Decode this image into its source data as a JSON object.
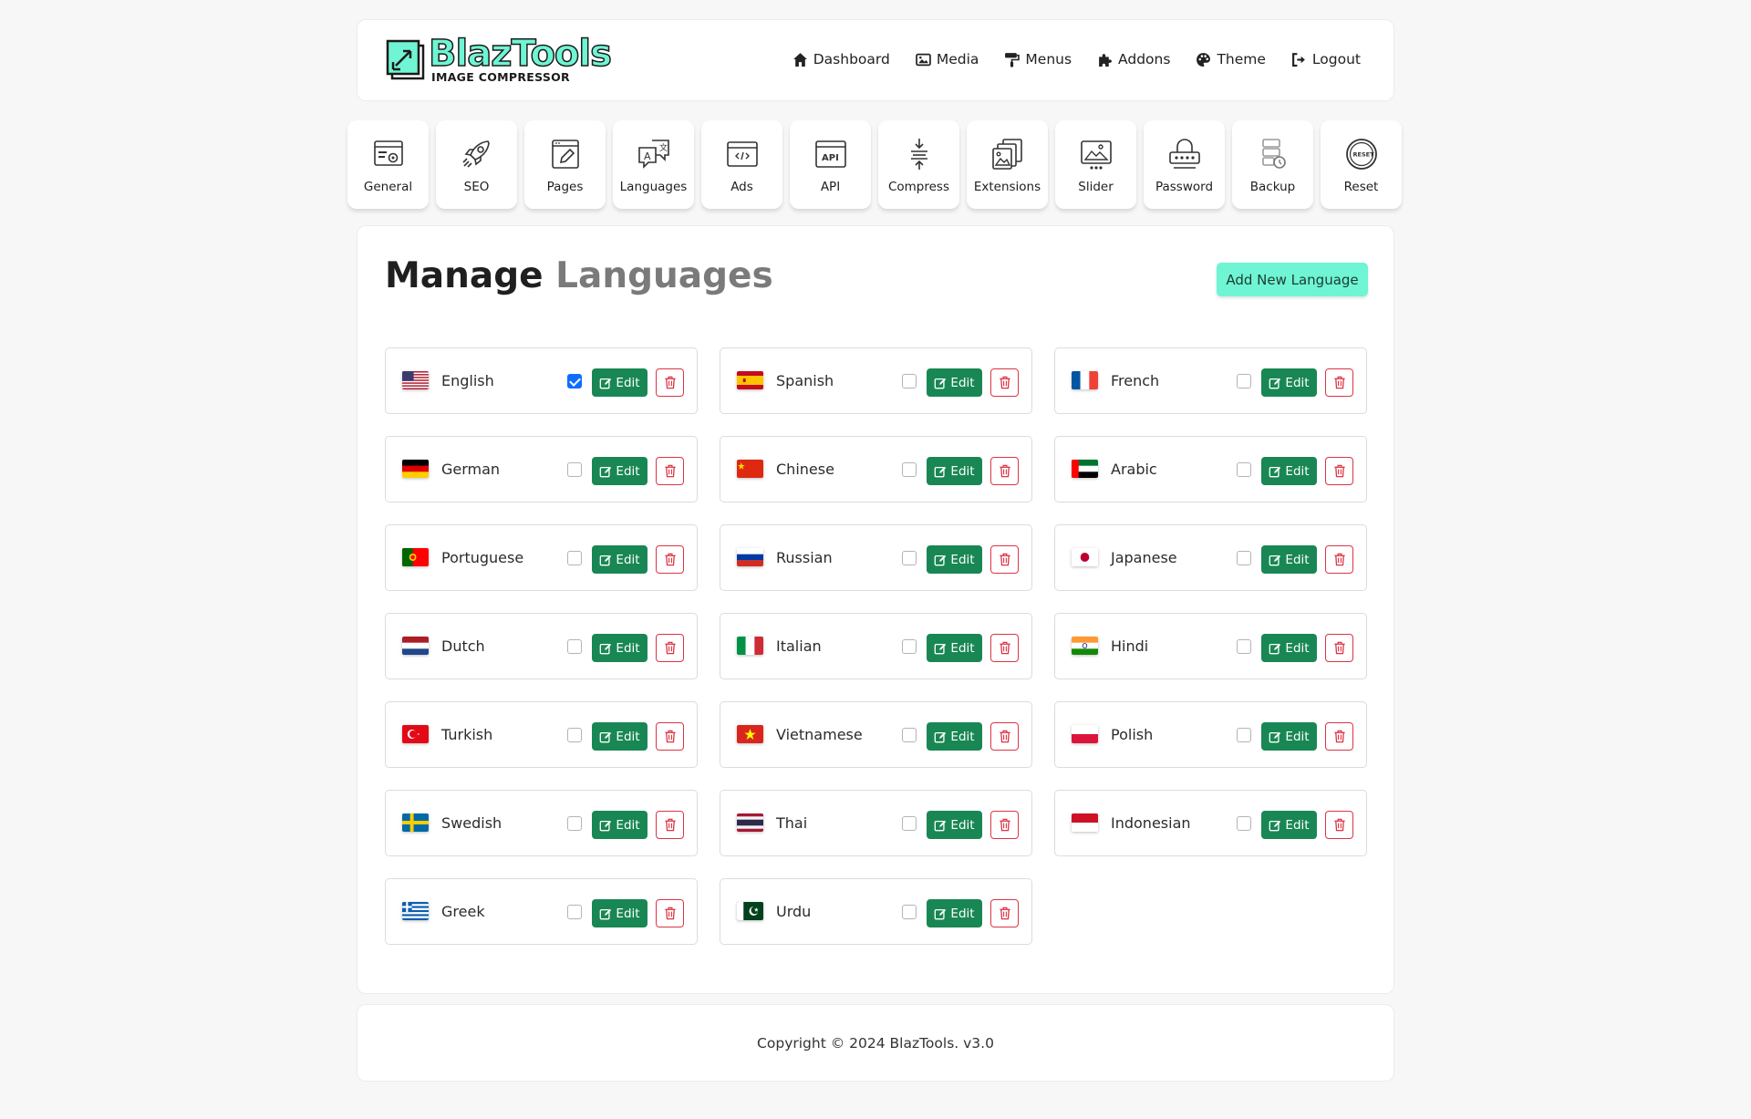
{
  "brand": {
    "name": "BlazTools",
    "tagline": "IMAGE COMPRESSOR"
  },
  "nav": [
    {
      "label": "Dashboard",
      "icon": "home-icon"
    },
    {
      "label": "Media",
      "icon": "image-icon"
    },
    {
      "label": "Menus",
      "icon": "paint-roller-icon"
    },
    {
      "label": "Addons",
      "icon": "puzzle-icon"
    },
    {
      "label": "Theme",
      "icon": "palette-icon"
    },
    {
      "label": "Logout",
      "icon": "logout-icon"
    }
  ],
  "tabs": [
    {
      "label": "General",
      "icon": "general-settings-icon"
    },
    {
      "label": "SEO",
      "icon": "rocket-icon"
    },
    {
      "label": "Pages",
      "icon": "pages-icon"
    },
    {
      "label": "Languages",
      "icon": "languages-icon"
    },
    {
      "label": "Ads",
      "icon": "ads-code-icon"
    },
    {
      "label": "API",
      "icon": "api-icon"
    },
    {
      "label": "Compress",
      "icon": "compress-icon"
    },
    {
      "label": "Extensions",
      "icon": "extensions-icon"
    },
    {
      "label": "Slider",
      "icon": "slider-icon"
    },
    {
      "label": "Password",
      "icon": "password-icon"
    },
    {
      "label": "Backup",
      "icon": "backup-icon"
    },
    {
      "label": "Reset",
      "icon": "reset-icon"
    }
  ],
  "page": {
    "title_part1": "Manage",
    "title_part2": "Languages",
    "add_button": "Add New Language"
  },
  "edit_label": "Edit",
  "languages": [
    {
      "name": "English",
      "flag": "us",
      "default": true
    },
    {
      "name": "Spanish",
      "flag": "es",
      "default": false
    },
    {
      "name": "French",
      "flag": "fr",
      "default": false
    },
    {
      "name": "German",
      "flag": "de",
      "default": false
    },
    {
      "name": "Chinese",
      "flag": "cn",
      "default": false
    },
    {
      "name": "Arabic",
      "flag": "ae",
      "default": false
    },
    {
      "name": "Portuguese",
      "flag": "pt",
      "default": false
    },
    {
      "name": "Russian",
      "flag": "ru",
      "default": false
    },
    {
      "name": "Japanese",
      "flag": "jp",
      "default": false
    },
    {
      "name": "Dutch",
      "flag": "nl",
      "default": false
    },
    {
      "name": "Italian",
      "flag": "it",
      "default": false
    },
    {
      "name": "Hindi",
      "flag": "in",
      "default": false
    },
    {
      "name": "Turkish",
      "flag": "tr",
      "default": false
    },
    {
      "name": "Vietnamese",
      "flag": "vn",
      "default": false
    },
    {
      "name": "Polish",
      "flag": "pl",
      "default": false
    },
    {
      "name": "Swedish",
      "flag": "se",
      "default": false
    },
    {
      "name": "Thai",
      "flag": "th",
      "default": false
    },
    {
      "name": "Indonesian",
      "flag": "id",
      "default": false
    },
    {
      "name": "Greek",
      "flag": "gr",
      "default": false
    },
    {
      "name": "Urdu",
      "flag": "pk",
      "default": false
    }
  ],
  "footer": {
    "copyright": "Copyright © 2024 BlazTools. v3.0"
  },
  "colors": {
    "accent": "#6ff5d3",
    "edit_button": "#198754",
    "delete_border": "#dc3545",
    "checkbox_on": "#0d6efd"
  }
}
